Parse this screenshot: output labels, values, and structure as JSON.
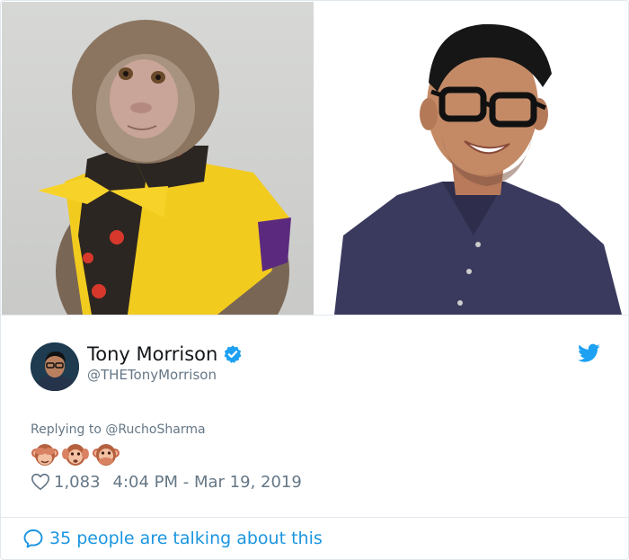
{
  "tweet": {
    "display_name": "Tony Morrison",
    "handle": "@THETonyMorrison",
    "replying_prefix": "Replying to ",
    "replying_to": "@RuchoSharma",
    "likes": "1,083",
    "timestamp": "4:04 PM - Mar 19, 2019",
    "talking": "35 people are talking about this",
    "emoji": [
      "see-no-evil-monkey",
      "hear-no-evil-monkey",
      "speak-no-evil-monkey"
    ]
  },
  "icons": {
    "verified": "verified-badge-icon",
    "brand": "twitter-bird-icon",
    "like": "heart-icon",
    "reply": "speech-bubble-icon"
  },
  "colors": {
    "brand_blue": "#1da1f2",
    "link_blue": "#1b95e0",
    "muted_gray": "#657786",
    "text": "#14171a",
    "border": "#e1e8ed"
  }
}
